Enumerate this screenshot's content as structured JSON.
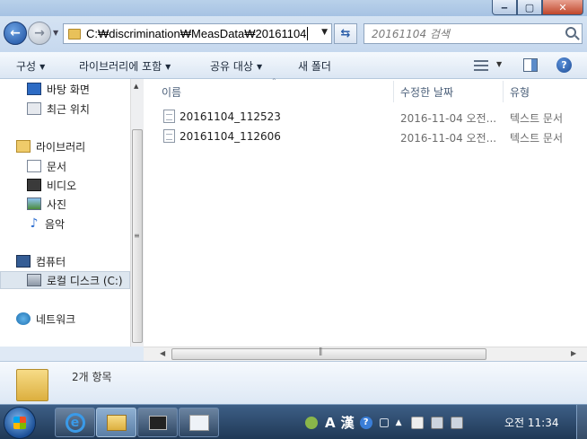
{
  "window": {
    "controls": {
      "minimize": "‒",
      "maximize": "▢",
      "close": "✕"
    }
  },
  "navigation": {
    "address_path": "C:₩discrimination₩MeasData₩20161104",
    "search_placeholder": "20161104 검색"
  },
  "toolbar": {
    "organize": "구성",
    "include_in_library": "라이브러리에 포함",
    "share_with": "공유 대상",
    "new_folder": "새 폴더",
    "help": "?"
  },
  "sidebar": {
    "items": [
      {
        "label": "바탕 화면",
        "icon": "desktop-icon"
      },
      {
        "label": "최근 위치",
        "icon": "recent-places-icon"
      },
      {
        "label": "라이브러리",
        "icon": "libraries-icon"
      },
      {
        "label": "문서",
        "icon": "documents-icon"
      },
      {
        "label": "비디오",
        "icon": "videos-icon"
      },
      {
        "label": "사진",
        "icon": "pictures-icon"
      },
      {
        "label": "음악",
        "icon": "music-icon"
      },
      {
        "label": "컴퓨터",
        "icon": "computer-icon"
      },
      {
        "label": "로컬 디스크 (C:)",
        "icon": "local-disk-icon",
        "selected": true
      },
      {
        "label": "네트워크",
        "icon": "network-icon"
      }
    ]
  },
  "file_list": {
    "columns": [
      "이름",
      "수정한 날짜",
      "유형"
    ],
    "rows": [
      {
        "name": "20161104_112523",
        "modified": "2016-11-04 오전...",
        "type": "텍스트 문서"
      },
      {
        "name": "20161104_112606",
        "modified": "2016-11-04 오전...",
        "type": "텍스트 문서"
      }
    ]
  },
  "details_pane": {
    "item_count": "2개 항목"
  },
  "taskbar": {
    "ime_mode": "A",
    "ime_hanja": "漢",
    "clock": "오전 11:34"
  }
}
